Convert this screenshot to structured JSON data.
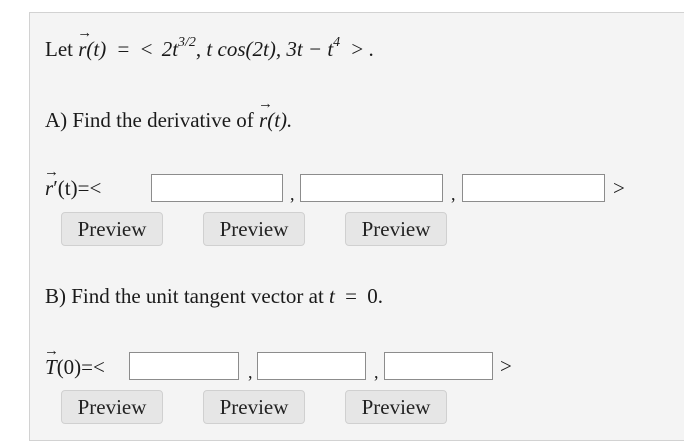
{
  "question": {
    "intro_let": "Let",
    "intro_r": "r",
    "intro_of_t": "(t)",
    "intro_eq": "=",
    "intro_lt": "<",
    "intro_c1_coef": "2t",
    "intro_c1_exp": "3/2",
    "intro_c1_end": ",",
    "intro_c2": "t cos(2t),",
    "intro_c3_a": "3t − t",
    "intro_c3_exp": "4",
    "intro_gt": "> .",
    "arrow_glyph": "→"
  },
  "part_a": {
    "prompt_text": "A) Find the derivative of",
    "prompt_r": "r",
    "prompt_end": "(t).",
    "answer_label_r": "r",
    "answer_label_rest": "′(t)=<",
    "inputs": [
      {
        "value": "",
        "placeholder": ""
      },
      {
        "value": "",
        "placeholder": ""
      },
      {
        "value": "",
        "placeholder": ""
      }
    ],
    "separator": ",",
    "closer": ">",
    "preview_labels": [
      "Preview",
      "Preview",
      "Preview"
    ]
  },
  "part_b": {
    "prompt_text": "B) Find the unit tangent vector at",
    "prompt_t": "t",
    "prompt_eq": "=",
    "prompt_val": "0.",
    "answer_label_T": "T",
    "answer_label_rest": "(0)=<",
    "inputs": [
      {
        "value": "",
        "placeholder": ""
      },
      {
        "value": "",
        "placeholder": ""
      },
      {
        "value": "",
        "placeholder": ""
      }
    ],
    "separator": ",",
    "closer": ">",
    "preview_labels": [
      "Preview",
      "Preview",
      "Preview"
    ]
  }
}
